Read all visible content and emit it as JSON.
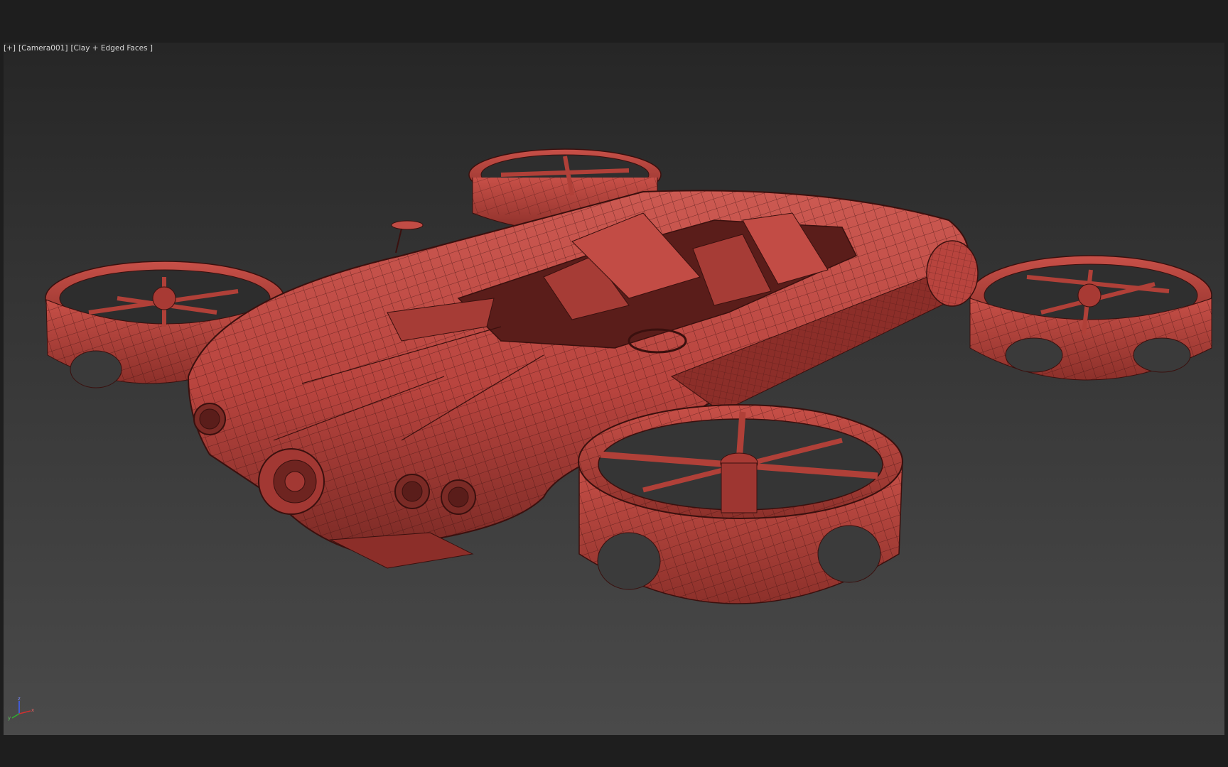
{
  "viewport": {
    "label_plus": "[+]",
    "label_camera": "[Camera001]",
    "label_shading": "[Clay + Edged Faces ]",
    "object": "flying-car-wireframe-model"
  },
  "gizmo": {
    "axis_z": "z",
    "axis_x": "x",
    "axis_y": "y",
    "colors": {
      "x": "#d23030",
      "y": "#30b030",
      "z": "#4060ff"
    }
  },
  "colors": {
    "background_top": "#262626",
    "background_bottom": "#4a4a4a",
    "clay": "#b8443e",
    "clay_light": "#cc5a52",
    "clay_dark": "#6e2420",
    "edge": "#3a100e",
    "label_text": "#d8d8d8"
  }
}
